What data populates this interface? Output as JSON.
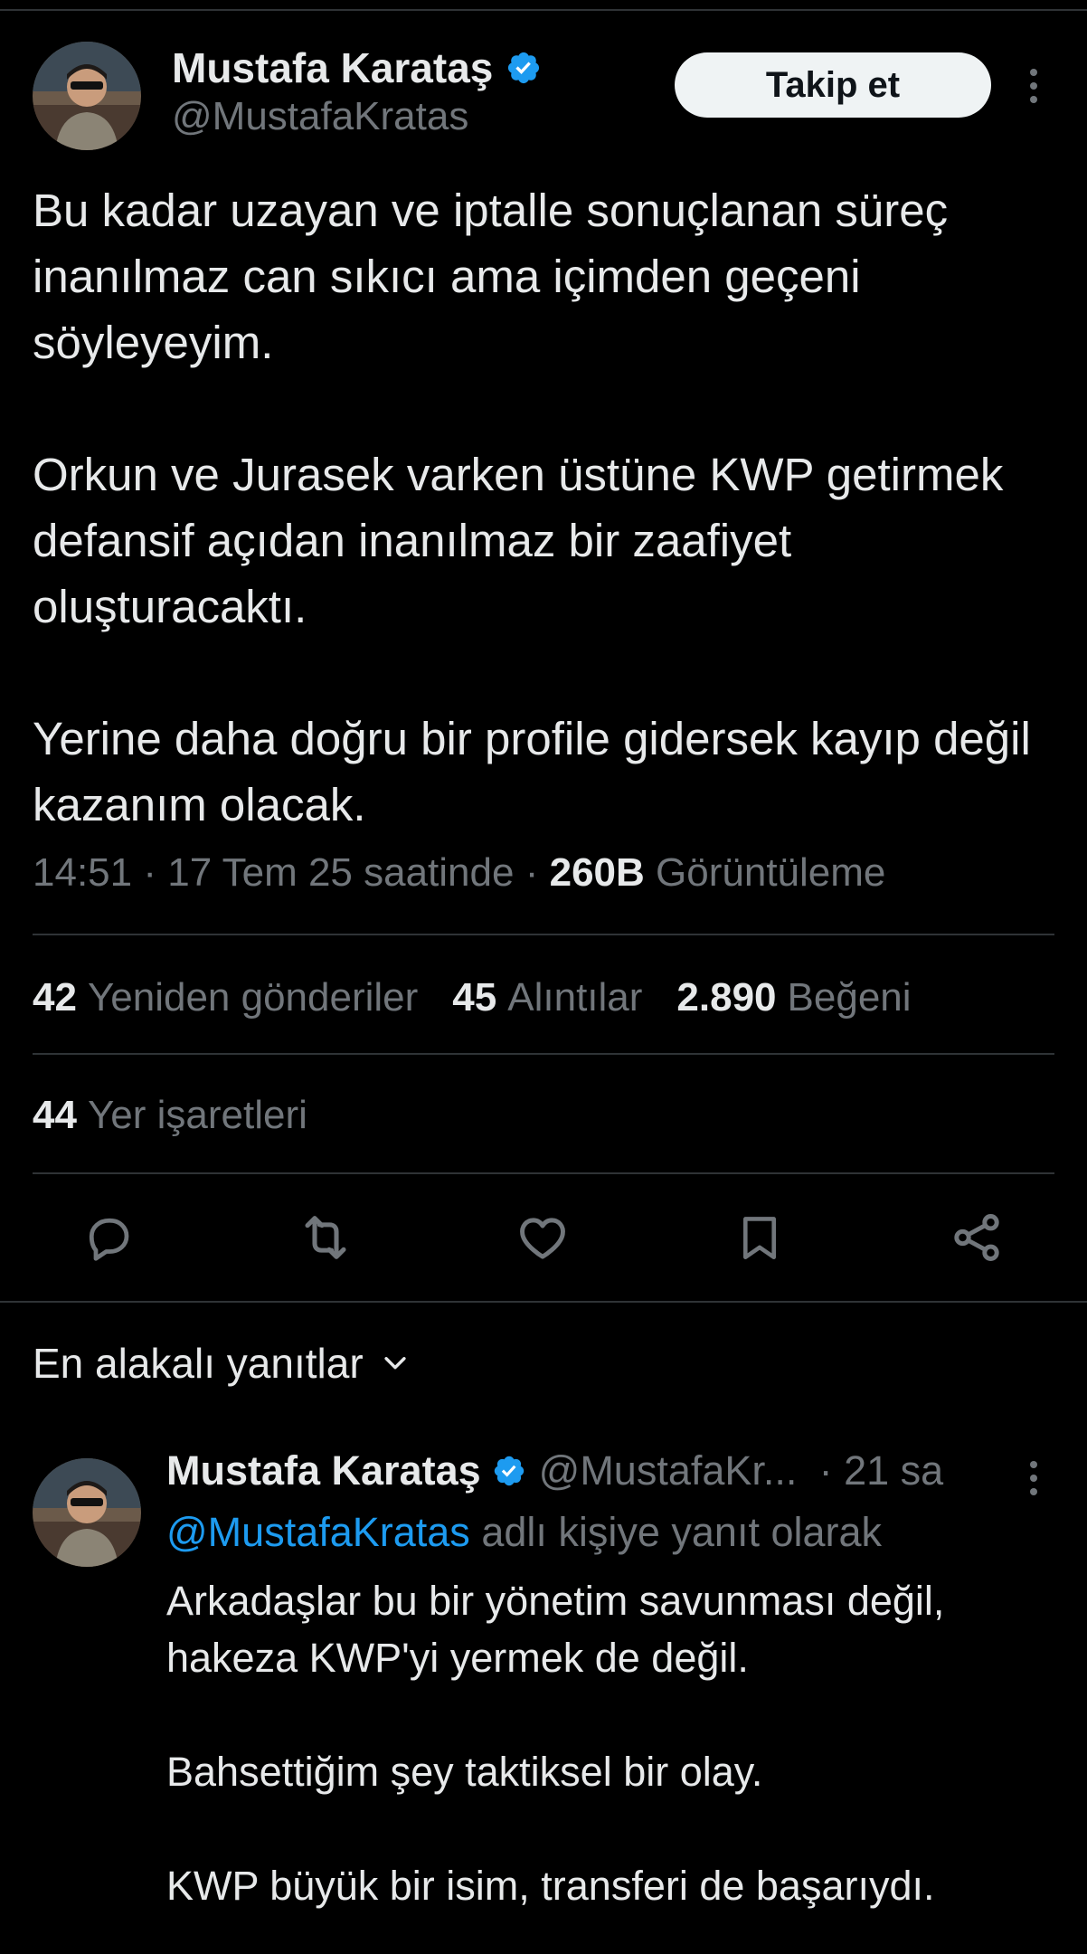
{
  "colors": {
    "background": "#000000",
    "text": "#e7e9ea",
    "muted": "#71767b",
    "link": "#1d9bf0",
    "verified": "#1d9bf0",
    "divider": "#2f3336"
  },
  "tweet": {
    "author": {
      "name": "Mustafa Karataş",
      "handle": "@MustafaKratas",
      "verified_icon": "verified-badge-icon",
      "avatar_icon": "profile-photo"
    },
    "follow_label": "Takip et",
    "more_icon": "more-vertical-icon",
    "paragraphs": [
      "Bu kadar uzayan ve iptalle sonuçlanan süreç inanılmaz can sıkıcı ama içimden geçeni söyleyeyim.",
      "Orkun ve Jurasek varken üstüne KWP getirmek defansif açıdan inanılmaz bir zaafiyet oluşturacaktı.",
      "Yerine daha doğru bir profile gidersek kayıp değil kazanım olacak."
    ],
    "meta": {
      "time": "14:51",
      "sep1": "·",
      "date": "17 Tem 25 saatinde",
      "sep2": "·",
      "views_count": "260B",
      "views_label": "Görüntüleme"
    },
    "stats": {
      "reposts_count": "42",
      "reposts_label": "Yeniden gönderiler",
      "quotes_count": "45",
      "quotes_label": "Alıntılar",
      "likes_count": "2.890",
      "likes_label": "Beğeni",
      "bookmarks_count": "44",
      "bookmarks_label": "Yer işaretleri"
    },
    "actions": [
      "reply-icon",
      "repost-icon",
      "like-icon",
      "bookmark-icon",
      "share-icon"
    ]
  },
  "replies_sort": {
    "label": "En alakalı yanıtlar",
    "icon": "chevron-down-icon"
  },
  "reply": {
    "author": {
      "name": "Mustafa Karataş",
      "handle": "@MustafaKr...",
      "verified_icon": "verified-badge-icon"
    },
    "time": "· 21 sa",
    "replying_to_mention": "@MustafaKratas",
    "replying_to_suffix": "adlı kişiye yanıt olarak",
    "paragraphs": [
      "Arkadaşlar bu bir yönetim savunması değil, hakeza KWP'yi yermek de değil.",
      "Bahsettiğim şey taktiksel bir olay.",
      "KWP büyük bir isim, transferi de başarıydı."
    ]
  }
}
